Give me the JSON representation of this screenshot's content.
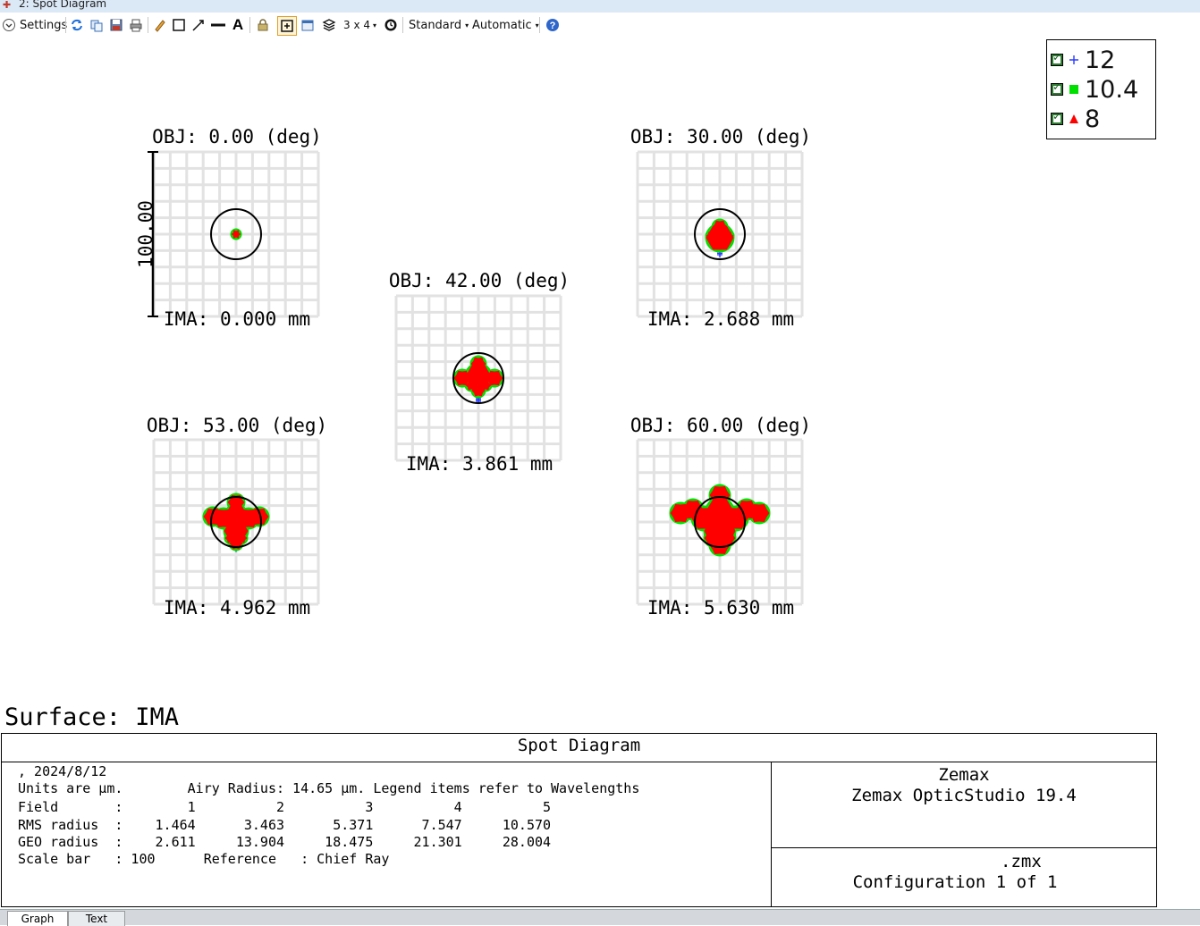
{
  "window": {
    "title": "2: Spot Diagram"
  },
  "toolbar": {
    "settings_label": "Settings",
    "layout_label": "3 x 4",
    "standard_label": "Standard",
    "automatic_label": "Automatic"
  },
  "legend": {
    "items": [
      {
        "label": "12",
        "marker": "plus",
        "color": "#2a3cff"
      },
      {
        "label": "10.4",
        "marker": "square",
        "color": "#00e000"
      },
      {
        "label": "8",
        "marker": "triangle",
        "color": "#ff0000"
      }
    ]
  },
  "fields": [
    {
      "obj": "OBJ: 0.00 (deg)",
      "ima": "IMA: 0.000 mm",
      "rms": 1.464,
      "geo": 2.611
    },
    {
      "obj": "OBJ: 30.00 (deg)",
      "ima": "IMA: 2.688 mm",
      "rms": 3.463,
      "geo": 13.904
    },
    {
      "obj": "OBJ: 42.00 (deg)",
      "ima": "IMA: 3.861 mm",
      "rms": 5.371,
      "geo": 18.475
    },
    {
      "obj": "OBJ: 53.00 (deg)",
      "ima": "IMA: 4.962 mm",
      "rms": 7.547,
      "geo": 21.301
    },
    {
      "obj": "OBJ: 60.00 (deg)",
      "ima": "IMA: 5.630 mm",
      "rms": 10.57,
      "geo": 28.004
    }
  ],
  "scale_bar_label": "100.00",
  "airy_radius": 14.65,
  "surface_label": "Surface: IMA",
  "info": {
    "title": "Spot Diagram",
    "date": ", 2024/8/12",
    "units_line": "Units are µm.        Airy Radius: 14.65 µm. Legend items refer to Wavelengths",
    "field_line": "Field       :        1          2          3          4          5",
    "rms_line": "RMS radius  :    1.464      3.463      5.371      7.547     10.570",
    "geo_line": "GEO radius  :    2.611     13.904     18.475     21.301     28.004",
    "scale_line": "Scale bar   : 100      Reference   : Chief Ray",
    "company": "Zemax",
    "product": "Zemax OpticStudio 19.4",
    "file": ".zmx",
    "config": "Configuration 1 of 1"
  },
  "tabs": {
    "graph": "Graph",
    "text": "Text"
  }
}
